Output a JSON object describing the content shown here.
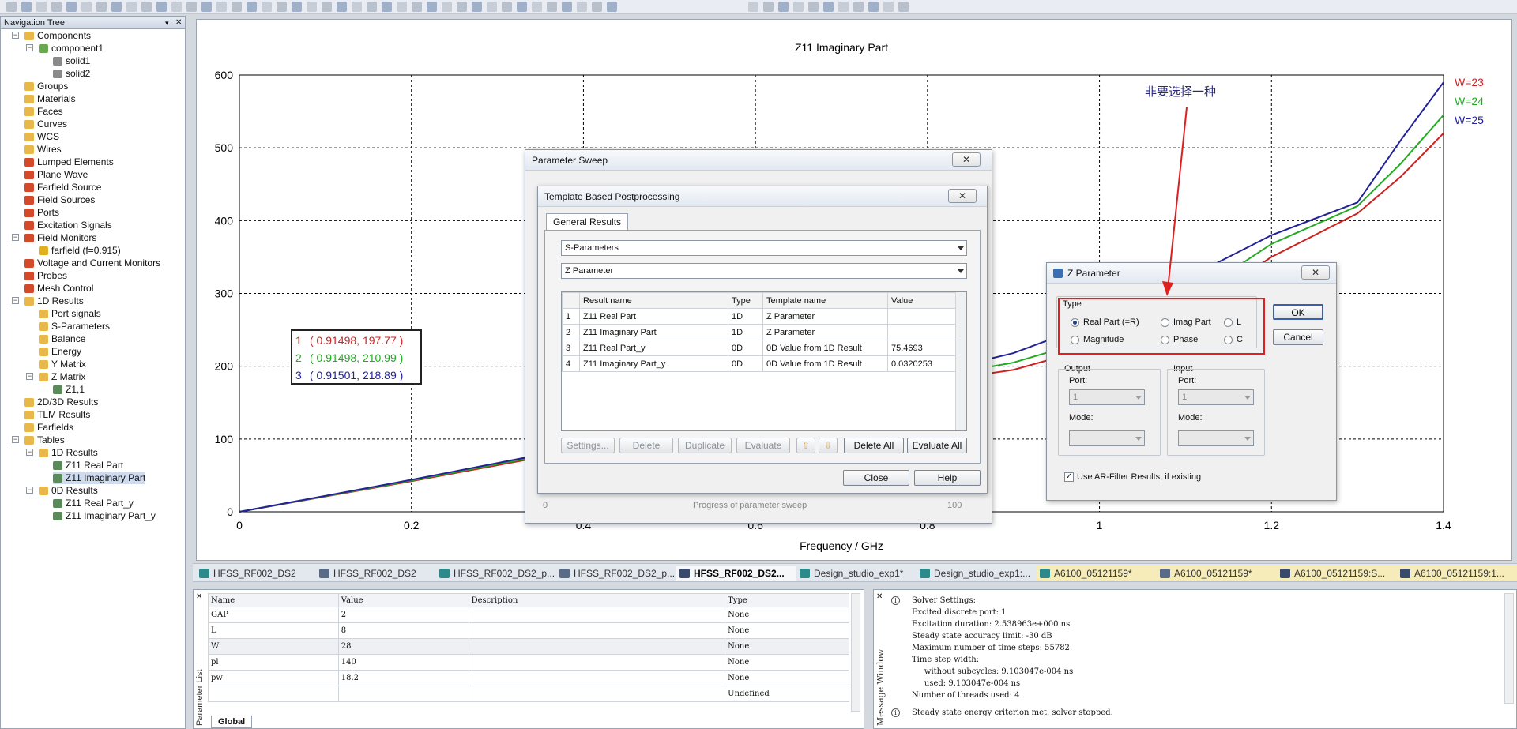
{
  "nav": {
    "title": "Navigation Tree",
    "items": [
      {
        "label": "Components",
        "level": 0,
        "icon": "folder-icon"
      },
      {
        "label": "component1",
        "level": 1,
        "icon": "component-icon"
      },
      {
        "label": "solid1",
        "level": 2,
        "icon": "solid-icon"
      },
      {
        "label": "solid2",
        "level": 2,
        "icon": "solid-icon"
      },
      {
        "label": "Groups",
        "level": 0,
        "icon": "folder-icon"
      },
      {
        "label": "Materials",
        "level": 0,
        "icon": "folder-icon"
      },
      {
        "label": "Faces",
        "level": 0,
        "icon": "folder-icon"
      },
      {
        "label": "Curves",
        "level": 0,
        "icon": "folder-icon"
      },
      {
        "label": "WCS",
        "level": 0,
        "icon": "folder-icon"
      },
      {
        "label": "Wires",
        "level": 0,
        "icon": "folder-icon"
      },
      {
        "label": "Lumped Elements",
        "level": 0,
        "icon": "red-folder-icon"
      },
      {
        "label": "Plane Wave",
        "level": 0,
        "icon": "red-folder-icon"
      },
      {
        "label": "Farfield Source",
        "level": 0,
        "icon": "red-folder-icon"
      },
      {
        "label": "Field Sources",
        "level": 0,
        "icon": "red-folder-icon"
      },
      {
        "label": "Ports",
        "level": 0,
        "icon": "red-folder-icon"
      },
      {
        "label": "Excitation Signals",
        "level": 0,
        "icon": "red-folder-icon"
      },
      {
        "label": "Field Monitors",
        "level": 0,
        "icon": "red-folder-icon"
      },
      {
        "label": "farfield (f=0.915)",
        "level": 1,
        "icon": "monitor-icon"
      },
      {
        "label": "Voltage and Current Monitors",
        "level": 0,
        "icon": "red-folder-icon"
      },
      {
        "label": "Probes",
        "level": 0,
        "icon": "red-folder-icon"
      },
      {
        "label": "Mesh Control",
        "level": 0,
        "icon": "red-folder-icon"
      },
      {
        "label": "1D Results",
        "level": 0,
        "icon": "folder-icon"
      },
      {
        "label": "Port signals",
        "level": 1,
        "icon": "folder-icon"
      },
      {
        "label": "S-Parameters",
        "level": 1,
        "icon": "folder-icon"
      },
      {
        "label": "Balance",
        "level": 1,
        "icon": "folder-icon"
      },
      {
        "label": "Energy",
        "level": 1,
        "icon": "folder-icon"
      },
      {
        "label": "Y Matrix",
        "level": 1,
        "icon": "folder-icon"
      },
      {
        "label": "Z Matrix",
        "level": 1,
        "icon": "folder-icon"
      },
      {
        "label": "Z1,1",
        "level": 2,
        "icon": "chart-icon"
      },
      {
        "label": "2D/3D Results",
        "level": 0,
        "icon": "folder-icon"
      },
      {
        "label": "TLM Results",
        "level": 0,
        "icon": "folder-icon"
      },
      {
        "label": "Farfields",
        "level": 0,
        "icon": "folder-icon"
      },
      {
        "label": "Tables",
        "level": 0,
        "icon": "folder-icon"
      },
      {
        "label": "1D Results",
        "level": 1,
        "icon": "folder-icon"
      },
      {
        "label": "Z11 Real Part",
        "level": 2,
        "icon": "chart-icon"
      },
      {
        "label": "Z11 Imaginary Part",
        "level": 2,
        "icon": "chart-icon",
        "selected": true
      },
      {
        "label": "0D Results",
        "level": 1,
        "icon": "folder-icon"
      },
      {
        "label": "Z11 Real Part_y",
        "level": 2,
        "icon": "chart-icon"
      },
      {
        "label": "Z11 Imaginary Part_y",
        "level": 2,
        "icon": "chart-icon"
      }
    ]
  },
  "chart_data": {
    "type": "line",
    "title": "Z11 Imaginary Part",
    "xlabel": "Frequency / GHz",
    "ylabel": "",
    "xlim": [
      0,
      1.4
    ],
    "ylim": [
      0,
      600
    ],
    "xticks": [
      "0",
      "0.2",
      "0.4",
      "0.6",
      "0.8",
      "1",
      "1.2",
      "1.4"
    ],
    "yticks": [
      "0",
      "100",
      "200",
      "300",
      "400",
      "500",
      "600"
    ],
    "grid": true,
    "legend_position": "top-right",
    "series": [
      {
        "name": "W=23",
        "color": "#cc2222",
        "x": [
          0,
          0.2,
          0.4,
          0.6,
          0.8,
          0.9,
          1.0,
          1.1,
          1.2,
          1.3,
          1.35,
          1.4
        ],
        "values": [
          0,
          42,
          86,
          133,
          178,
          195,
          228,
          272,
          350,
          410,
          460,
          520
        ]
      },
      {
        "name": "W=24",
        "color": "#22aa22",
        "x": [
          0,
          0.2,
          0.4,
          0.6,
          0.8,
          0.9,
          1.0,
          1.1,
          1.2,
          1.3,
          1.35,
          1.4
        ],
        "values": [
          0,
          43,
          88,
          137,
          184,
          205,
          240,
          290,
          368,
          420,
          478,
          545
        ]
      },
      {
        "name": "W=25",
        "color": "#222299",
        "x": [
          0,
          0.2,
          0.4,
          0.6,
          0.8,
          0.9,
          1.0,
          1.1,
          1.2,
          1.3,
          1.35,
          1.4
        ],
        "values": [
          0,
          44,
          90,
          141,
          190,
          218,
          262,
          320,
          380,
          425,
          510,
          590
        ]
      }
    ],
    "marker_box": [
      {
        "id": "1",
        "text": "( 0.91498, 197.77 )",
        "color": "#cc2222"
      },
      {
        "id": "2",
        "text": "( 0.91498, 210.99 )",
        "color": "#22aa22"
      },
      {
        "id": "3",
        "text": "( 0.91501, 218.89 )",
        "color": "#222299"
      }
    ],
    "annotation": "非要选择一种"
  },
  "param_sweep": {
    "title": "Parameter Sweep",
    "progress_label": "Progress of parameter sweep",
    "progress_min": "0",
    "progress_max": "100"
  },
  "tbp": {
    "title": "Template Based Postprocessing",
    "tab": "General Results",
    "combo1": "S-Parameters",
    "combo2": "Z Parameter",
    "columns": [
      "Result name",
      "Type",
      "Template name",
      "Value"
    ],
    "rows": [
      {
        "n": "1",
        "name": "Z11 Real Part",
        "type": "1D",
        "template": "Z Parameter",
        "value": ""
      },
      {
        "n": "2",
        "name": "Z11 Imaginary Part",
        "type": "1D",
        "template": "Z Parameter",
        "value": ""
      },
      {
        "n": "3",
        "name": "Z11 Real Part_y",
        "type": "0D",
        "template": "0D Value from 1D Result",
        "value": "75.4693"
      },
      {
        "n": "4",
        "name": "Z11 Imaginary Part_y",
        "type": "0D",
        "template": "0D Value from 1D Result",
        "value": "0.0320253"
      }
    ],
    "buttons": {
      "settings": "Settings...",
      "delete": "Delete",
      "duplicate": "Duplicate",
      "evaluate": "Evaluate",
      "delete_all": "Delete All",
      "evaluate_all": "Evaluate All",
      "close": "Close",
      "help": "Help"
    }
  },
  "zparam": {
    "title": "Z Parameter",
    "type_label": "Type",
    "options": {
      "real": "Real Part (=R)",
      "imag": "Imag Part",
      "l": "L",
      "mag": "Magnitude",
      "phase": "Phase",
      "c": "C"
    },
    "output_label": "Output",
    "input_label": "Input",
    "port_label": "Port:",
    "mode_label": "Mode:",
    "port_value": "1",
    "checkbox_label": "Use AR-Filter Results, if existing",
    "ok": "OK",
    "cancel": "Cancel"
  },
  "tabs": [
    {
      "label": "HFSS_RF002_DS2",
      "color": "#2c8a8a"
    },
    {
      "label": "HFSS_RF002_DS2",
      "color": "#5a6b85"
    },
    {
      "label": "HFSS_RF002_DS2_p...",
      "color": "#2c8a8a"
    },
    {
      "label": "HFSS_RF002_DS2_p...",
      "color": "#5a6b85"
    },
    {
      "label": "HFSS_RF002_DS2...",
      "color": "#3a4a6a",
      "active": true
    },
    {
      "label": "Design_studio_exp1*",
      "color": "#2c8a8a"
    },
    {
      "label": "Design_studio_exp1:...",
      "color": "#2c8a8a"
    },
    {
      "label": "A6100_05121159*",
      "color": "#2c8a8a",
      "yellow": true
    },
    {
      "label": "A6100_05121159*",
      "color": "#5a6b85",
      "yellow": true
    },
    {
      "label": "A6100_05121159:S...",
      "color": "#3a4a6a",
      "yellow": true
    },
    {
      "label": "A6100_05121159:1...",
      "color": "#3a4a6a",
      "yellow": true
    }
  ],
  "params": {
    "panel_label": "Parameter List",
    "tab": "Global",
    "columns": [
      "Name",
      "Value",
      "Description",
      "Type"
    ],
    "rows": [
      {
        "name": "GAP",
        "value": "2",
        "desc": "",
        "type": "None"
      },
      {
        "name": "L",
        "value": "8",
        "desc": "",
        "type": "None"
      },
      {
        "name": "W",
        "value": "28",
        "desc": "",
        "type": "None"
      },
      {
        "name": "pl",
        "value": "140",
        "desc": "",
        "type": "None"
      },
      {
        "name": "pw",
        "value": "18.2",
        "desc": "",
        "type": "None"
      },
      {
        "name": "",
        "value": "",
        "desc": "",
        "type": "Undefined"
      }
    ]
  },
  "messages": {
    "panel_label": "Message Window",
    "lines": [
      "Solver Settings:",
      "Excited discrete port: 1",
      "Excitation duration: 2.538963e+000 ns",
      "Steady state accuracy limit: -30 dB",
      "Maximum number of time steps: 55782",
      "Time step width:",
      "     without subcycles: 9.103047e-004 ns",
      "     used: 9.103047e-004 ns",
      "Number of threads used: 4"
    ],
    "last": "Steady state energy criterion met, solver stopped."
  }
}
